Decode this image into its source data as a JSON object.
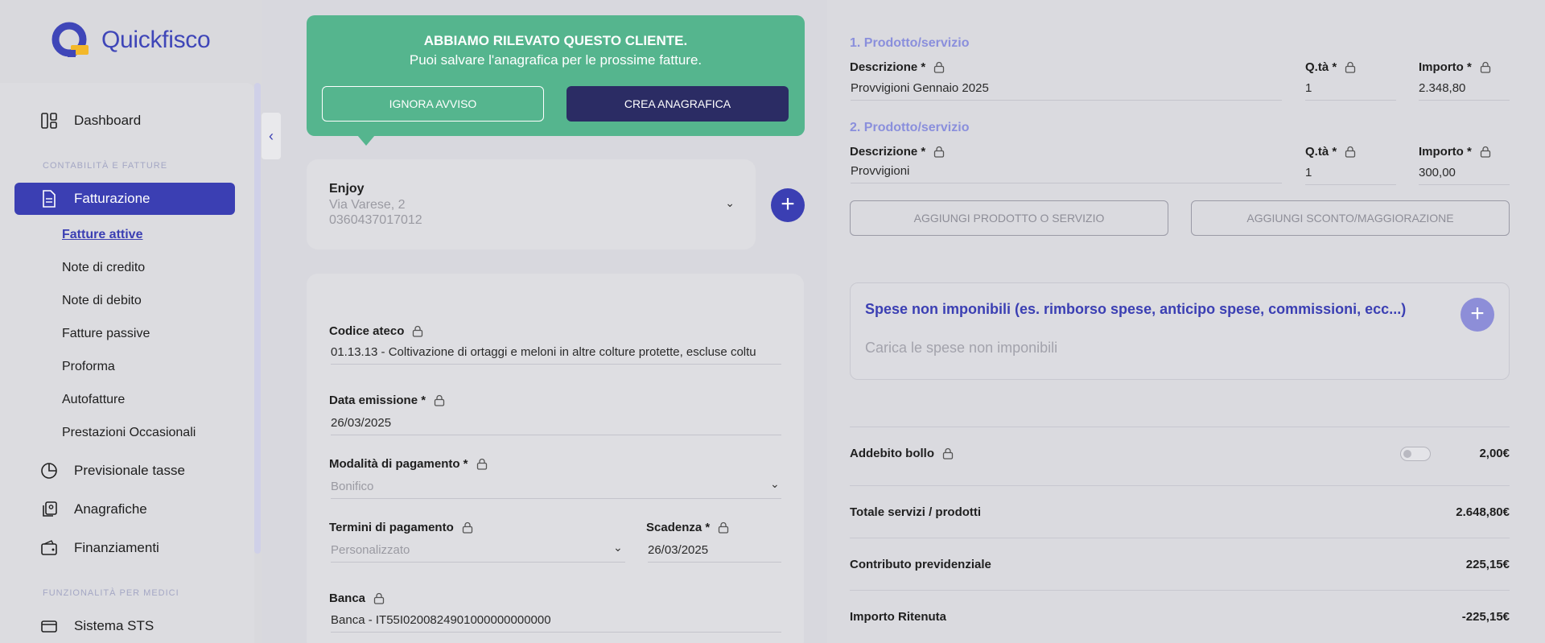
{
  "brand": {
    "name": "Quickfisco"
  },
  "sidebar": {
    "dashboard": "Dashboard",
    "section_accounting": "CONTABILITÀ E FATTURE",
    "fatturazione": "Fatturazione",
    "sub_items": [
      "Fatture attive",
      "Note di credito",
      "Note di debito",
      "Fatture passive",
      "Proforma",
      "Autofatture",
      "Prestazioni Occasionali"
    ],
    "previsionale": "Previsionale tasse",
    "anagrafiche": "Anagrafiche",
    "finanziamenti": "Finanziamenti",
    "section_medici": "FUNZIONALITÀ PER MEDICI",
    "sistema_sts": "Sistema STS"
  },
  "toast": {
    "title": "ABBIAMO RILEVATO QUESTO CLIENTE.",
    "subtitle": "Puoi salvare l'anagrafica per le prossime fatture.",
    "ignore_label": "IGNORA AVVISO",
    "create_label": "CREA ANAGRAFICA"
  },
  "client": {
    "name": "Enjoy",
    "address": "Via Varese, 2",
    "phone": "0360437017012"
  },
  "form": {
    "ateco_label": "Codice ateco",
    "ateco_value": "01.13.13 - Coltivazione di ortaggi e meloni in altre colture protette, escluse coltu",
    "data_label": "Data emissione *",
    "data_value": "26/03/2025",
    "modalita_label": "Modalità di pagamento *",
    "modalita_value": "Bonifico",
    "termini_label": "Termini di pagamento",
    "termini_value": "Personalizzato",
    "scadenza_label": "Scadenza *",
    "scadenza_value": "26/03/2025",
    "banca_label": "Banca",
    "banca_value": "Banca - IT55I0200824901000000000000"
  },
  "products": [
    {
      "title": "1. Prodotto/servizio",
      "desc_label": "Descrizione *",
      "desc": "Provvigioni Gennaio 2025",
      "qty_label": "Q.tà *",
      "qty": "1",
      "amount_label": "Importo *",
      "amount": "2.348,80"
    },
    {
      "title": "2. Prodotto/servizio",
      "desc_label": "Descrizione *",
      "desc": "Provvigioni",
      "qty_label": "Q.tà *",
      "qty": "1",
      "amount_label": "Importo *",
      "amount": "300,00"
    }
  ],
  "actions": {
    "add_product": "AGGIUNGI PRODOTTO O SERVIZIO",
    "add_discount": "AGGIUNGI SCONTO/MAGGIORAZIONE"
  },
  "spese": {
    "title": "Spese non imponibili (es. rimborso spese, anticipo spese, commissioni, ecc...)",
    "subtitle": "Carica le spese non imponibili"
  },
  "summary": {
    "bollo_label": "Addebito bollo",
    "bollo_value": "2,00€",
    "totale_label": "Totale servizi / prodotti",
    "totale_value": "2.648,80€",
    "contributo_label": "Contributo previdenziale",
    "contributo_value": "225,15€",
    "ritenuta_label": "Importo Ritenuta",
    "ritenuta_value": "-225,15€"
  },
  "colors": {
    "accent": "#3b3fb3",
    "success": "#55b58e",
    "dark": "#2b2c64"
  }
}
